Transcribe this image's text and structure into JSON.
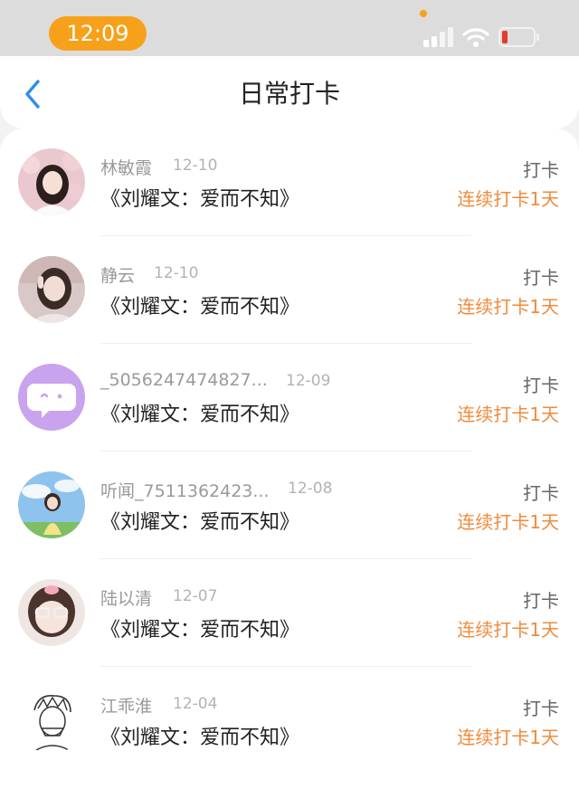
{
  "status_bar": {
    "time": "12:09",
    "colors": {
      "time_pill": "#f7a11a",
      "battery_low": "#e23a2f"
    }
  },
  "header": {
    "title": "日常打卡",
    "back_icon": "chevron-left-icon",
    "accent_color": "#2f8ee8"
  },
  "entries": [
    {
      "name": "林敏霞",
      "date": "12-10",
      "song": "《刘耀文：爱而不知》",
      "action": "打卡",
      "streak": "连续打卡1天"
    },
    {
      "name": "静云",
      "date": "12-10",
      "song": "《刘耀文：爱而不知》",
      "action": "打卡",
      "streak": "连续打卡1天"
    },
    {
      "name": "_5056247474827...",
      "date": "12-09",
      "song": "《刘耀文：爱而不知》",
      "action": "打卡",
      "streak": "连续打卡1天"
    },
    {
      "name": "听闻_7511362423...",
      "date": "12-08",
      "song": "《刘耀文：爱而不知》",
      "action": "打卡",
      "streak": "连续打卡1天"
    },
    {
      "name": "陆以清",
      "date": "12-07",
      "song": "《刘耀文：爱而不知》",
      "action": "打卡",
      "streak": "连续打卡1天"
    },
    {
      "name": "江乖淮",
      "date": "12-04",
      "song": "《刘耀文：爱而不知》",
      "action": "打卡",
      "streak": "连续打卡1天"
    }
  ],
  "colors": {
    "streak": "#f08a3b",
    "name": "#9a9a9a"
  }
}
